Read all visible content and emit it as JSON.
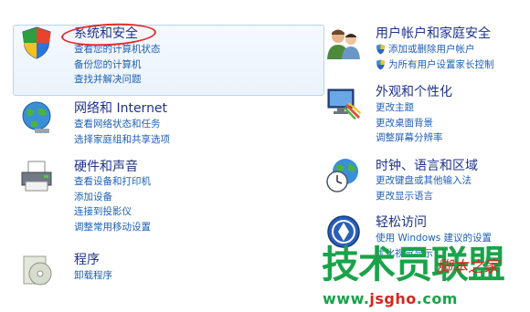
{
  "categories": [
    {
      "title": "系统和安全",
      "links": [
        "查看您的计算机状态",
        "备份您的计算机",
        "查找并解决问题"
      ]
    },
    {
      "title": "网络和 Internet",
      "links": [
        "查看网络状态和任务",
        "选择家庭组和共享选项"
      ]
    },
    {
      "title": "硬件和声音",
      "links": [
        "查看设备和打印机",
        "添加设备",
        "连接到投影仪",
        "调整常用移动设置"
      ]
    },
    {
      "title": "程序",
      "links": [
        "卸载程序"
      ]
    },
    {
      "title": "用户帐户和家庭安全",
      "links": [
        "添加或删除用户帐户",
        "为所有用户设置家长控制"
      ]
    },
    {
      "title": "外观和个性化",
      "links": [
        "更改主题",
        "更改桌面背景",
        "调整屏幕分辨率"
      ]
    },
    {
      "title": "时钟、语言和区域",
      "links": [
        "更改键盘或其他输入法",
        "更改显示语言"
      ]
    },
    {
      "title": "轻松访问",
      "links": [
        "使用 Windows 建议的设置",
        "优化视觉显示"
      ]
    }
  ],
  "watermark": {
    "main": "技术员联盟",
    "sub": "脚本之家",
    "url_prefix": "www.",
    "url_host": "jsgho",
    "url_suffix": ".com"
  },
  "colors": {
    "title": "#1e3287",
    "link": "#1e5fb4",
    "highlight_border": "#e52a2a",
    "watermark_green": "#1aa34a",
    "watermark_red": "#d2261f"
  }
}
